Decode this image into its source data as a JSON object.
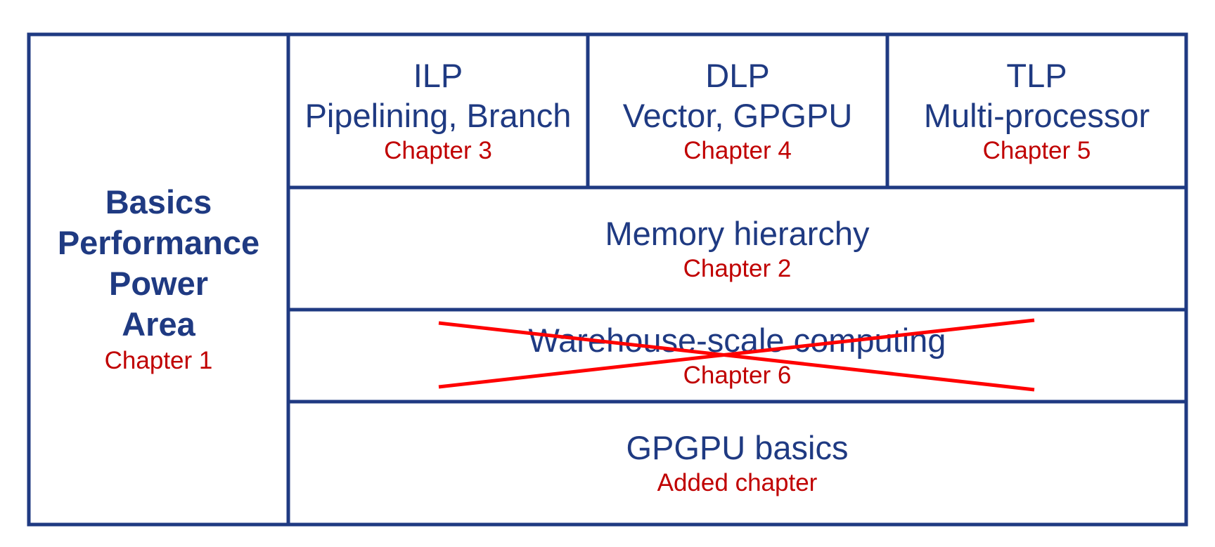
{
  "colors": {
    "border": "#1f3a82",
    "title_text": "#1f3a82",
    "chapter_text": "#c00000",
    "cross_out": "#ff0000"
  },
  "left_panel": {
    "lines": [
      "Basics",
      "Performance",
      "Power",
      "Area"
    ],
    "chapter": "Chapter 1"
  },
  "top_row": [
    {
      "title": "ILP",
      "subtitle": "Pipelining, Branch",
      "chapter": "Chapter 3"
    },
    {
      "title": "DLP",
      "subtitle": "Vector, GPGPU",
      "chapter": "Chapter 4"
    },
    {
      "title": "TLP",
      "subtitle": "Multi-processor",
      "chapter": "Chapter 5"
    }
  ],
  "memory": {
    "title": "Memory hierarchy",
    "chapter": "Chapter 2"
  },
  "warehouse": {
    "title": "Warehouse-scale computing",
    "chapter": "Chapter 6",
    "crossed_out": true
  },
  "gpgpu": {
    "title": "GPGPU basics",
    "chapter": "Added chapter"
  }
}
